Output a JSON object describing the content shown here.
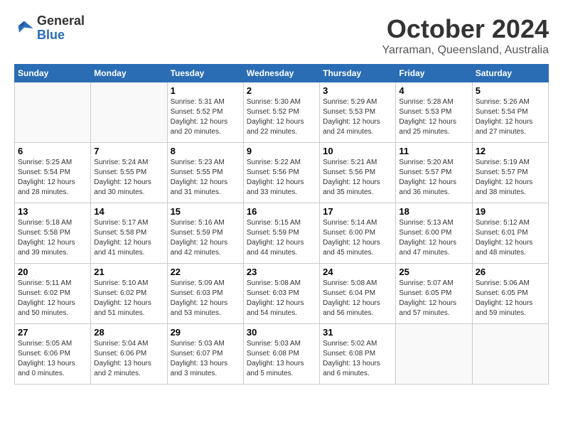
{
  "header": {
    "logo": {
      "general": "General",
      "blue": "Blue"
    },
    "title": "October 2024",
    "location": "Yarraman, Queensland, Australia"
  },
  "calendar": {
    "weekdays": [
      "Sunday",
      "Monday",
      "Tuesday",
      "Wednesday",
      "Thursday",
      "Friday",
      "Saturday"
    ],
    "weeks": [
      [
        {
          "day": "",
          "sunrise": "",
          "sunset": "",
          "daylight": ""
        },
        {
          "day": "",
          "sunrise": "",
          "sunset": "",
          "daylight": ""
        },
        {
          "day": "1",
          "sunrise": "Sunrise: 5:31 AM",
          "sunset": "Sunset: 5:52 PM",
          "daylight": "Daylight: 12 hours and 20 minutes."
        },
        {
          "day": "2",
          "sunrise": "Sunrise: 5:30 AM",
          "sunset": "Sunset: 5:52 PM",
          "daylight": "Daylight: 12 hours and 22 minutes."
        },
        {
          "day": "3",
          "sunrise": "Sunrise: 5:29 AM",
          "sunset": "Sunset: 5:53 PM",
          "daylight": "Daylight: 12 hours and 24 minutes."
        },
        {
          "day": "4",
          "sunrise": "Sunrise: 5:28 AM",
          "sunset": "Sunset: 5:53 PM",
          "daylight": "Daylight: 12 hours and 25 minutes."
        },
        {
          "day": "5",
          "sunrise": "Sunrise: 5:26 AM",
          "sunset": "Sunset: 5:54 PM",
          "daylight": "Daylight: 12 hours and 27 minutes."
        }
      ],
      [
        {
          "day": "6",
          "sunrise": "Sunrise: 5:25 AM",
          "sunset": "Sunset: 5:54 PM",
          "daylight": "Daylight: 12 hours and 28 minutes."
        },
        {
          "day": "7",
          "sunrise": "Sunrise: 5:24 AM",
          "sunset": "Sunset: 5:55 PM",
          "daylight": "Daylight: 12 hours and 30 minutes."
        },
        {
          "day": "8",
          "sunrise": "Sunrise: 5:23 AM",
          "sunset": "Sunset: 5:55 PM",
          "daylight": "Daylight: 12 hours and 31 minutes."
        },
        {
          "day": "9",
          "sunrise": "Sunrise: 5:22 AM",
          "sunset": "Sunset: 5:56 PM",
          "daylight": "Daylight: 12 hours and 33 minutes."
        },
        {
          "day": "10",
          "sunrise": "Sunrise: 5:21 AM",
          "sunset": "Sunset: 5:56 PM",
          "daylight": "Daylight: 12 hours and 35 minutes."
        },
        {
          "day": "11",
          "sunrise": "Sunrise: 5:20 AM",
          "sunset": "Sunset: 5:57 PM",
          "daylight": "Daylight: 12 hours and 36 minutes."
        },
        {
          "day": "12",
          "sunrise": "Sunrise: 5:19 AM",
          "sunset": "Sunset: 5:57 PM",
          "daylight": "Daylight: 12 hours and 38 minutes."
        }
      ],
      [
        {
          "day": "13",
          "sunrise": "Sunrise: 5:18 AM",
          "sunset": "Sunset: 5:58 PM",
          "daylight": "Daylight: 12 hours and 39 minutes."
        },
        {
          "day": "14",
          "sunrise": "Sunrise: 5:17 AM",
          "sunset": "Sunset: 5:58 PM",
          "daylight": "Daylight: 12 hours and 41 minutes."
        },
        {
          "day": "15",
          "sunrise": "Sunrise: 5:16 AM",
          "sunset": "Sunset: 5:59 PM",
          "daylight": "Daylight: 12 hours and 42 minutes."
        },
        {
          "day": "16",
          "sunrise": "Sunrise: 5:15 AM",
          "sunset": "Sunset: 5:59 PM",
          "daylight": "Daylight: 12 hours and 44 minutes."
        },
        {
          "day": "17",
          "sunrise": "Sunrise: 5:14 AM",
          "sunset": "Sunset: 6:00 PM",
          "daylight": "Daylight: 12 hours and 45 minutes."
        },
        {
          "day": "18",
          "sunrise": "Sunrise: 5:13 AM",
          "sunset": "Sunset: 6:00 PM",
          "daylight": "Daylight: 12 hours and 47 minutes."
        },
        {
          "day": "19",
          "sunrise": "Sunrise: 5:12 AM",
          "sunset": "Sunset: 6:01 PM",
          "daylight": "Daylight: 12 hours and 48 minutes."
        }
      ],
      [
        {
          "day": "20",
          "sunrise": "Sunrise: 5:11 AM",
          "sunset": "Sunset: 6:02 PM",
          "daylight": "Daylight: 12 hours and 50 minutes."
        },
        {
          "day": "21",
          "sunrise": "Sunrise: 5:10 AM",
          "sunset": "Sunset: 6:02 PM",
          "daylight": "Daylight: 12 hours and 51 minutes."
        },
        {
          "day": "22",
          "sunrise": "Sunrise: 5:09 AM",
          "sunset": "Sunset: 6:03 PM",
          "daylight": "Daylight: 12 hours and 53 minutes."
        },
        {
          "day": "23",
          "sunrise": "Sunrise: 5:08 AM",
          "sunset": "Sunset: 6:03 PM",
          "daylight": "Daylight: 12 hours and 54 minutes."
        },
        {
          "day": "24",
          "sunrise": "Sunrise: 5:08 AM",
          "sunset": "Sunset: 6:04 PM",
          "daylight": "Daylight: 12 hours and 56 minutes."
        },
        {
          "day": "25",
          "sunrise": "Sunrise: 5:07 AM",
          "sunset": "Sunset: 6:05 PM",
          "daylight": "Daylight: 12 hours and 57 minutes."
        },
        {
          "day": "26",
          "sunrise": "Sunrise: 5:06 AM",
          "sunset": "Sunset: 6:05 PM",
          "daylight": "Daylight: 12 hours and 59 minutes."
        }
      ],
      [
        {
          "day": "27",
          "sunrise": "Sunrise: 5:05 AM",
          "sunset": "Sunset: 6:06 PM",
          "daylight": "Daylight: 13 hours and 0 minutes."
        },
        {
          "day": "28",
          "sunrise": "Sunrise: 5:04 AM",
          "sunset": "Sunset: 6:06 PM",
          "daylight": "Daylight: 13 hours and 2 minutes."
        },
        {
          "day": "29",
          "sunrise": "Sunrise: 5:03 AM",
          "sunset": "Sunset: 6:07 PM",
          "daylight": "Daylight: 13 hours and 3 minutes."
        },
        {
          "day": "30",
          "sunrise": "Sunrise: 5:03 AM",
          "sunset": "Sunset: 6:08 PM",
          "daylight": "Daylight: 13 hours and 5 minutes."
        },
        {
          "day": "31",
          "sunrise": "Sunrise: 5:02 AM",
          "sunset": "Sunset: 6:08 PM",
          "daylight": "Daylight: 13 hours and 6 minutes."
        },
        {
          "day": "",
          "sunrise": "",
          "sunset": "",
          "daylight": ""
        },
        {
          "day": "",
          "sunrise": "",
          "sunset": "",
          "daylight": ""
        }
      ]
    ]
  }
}
